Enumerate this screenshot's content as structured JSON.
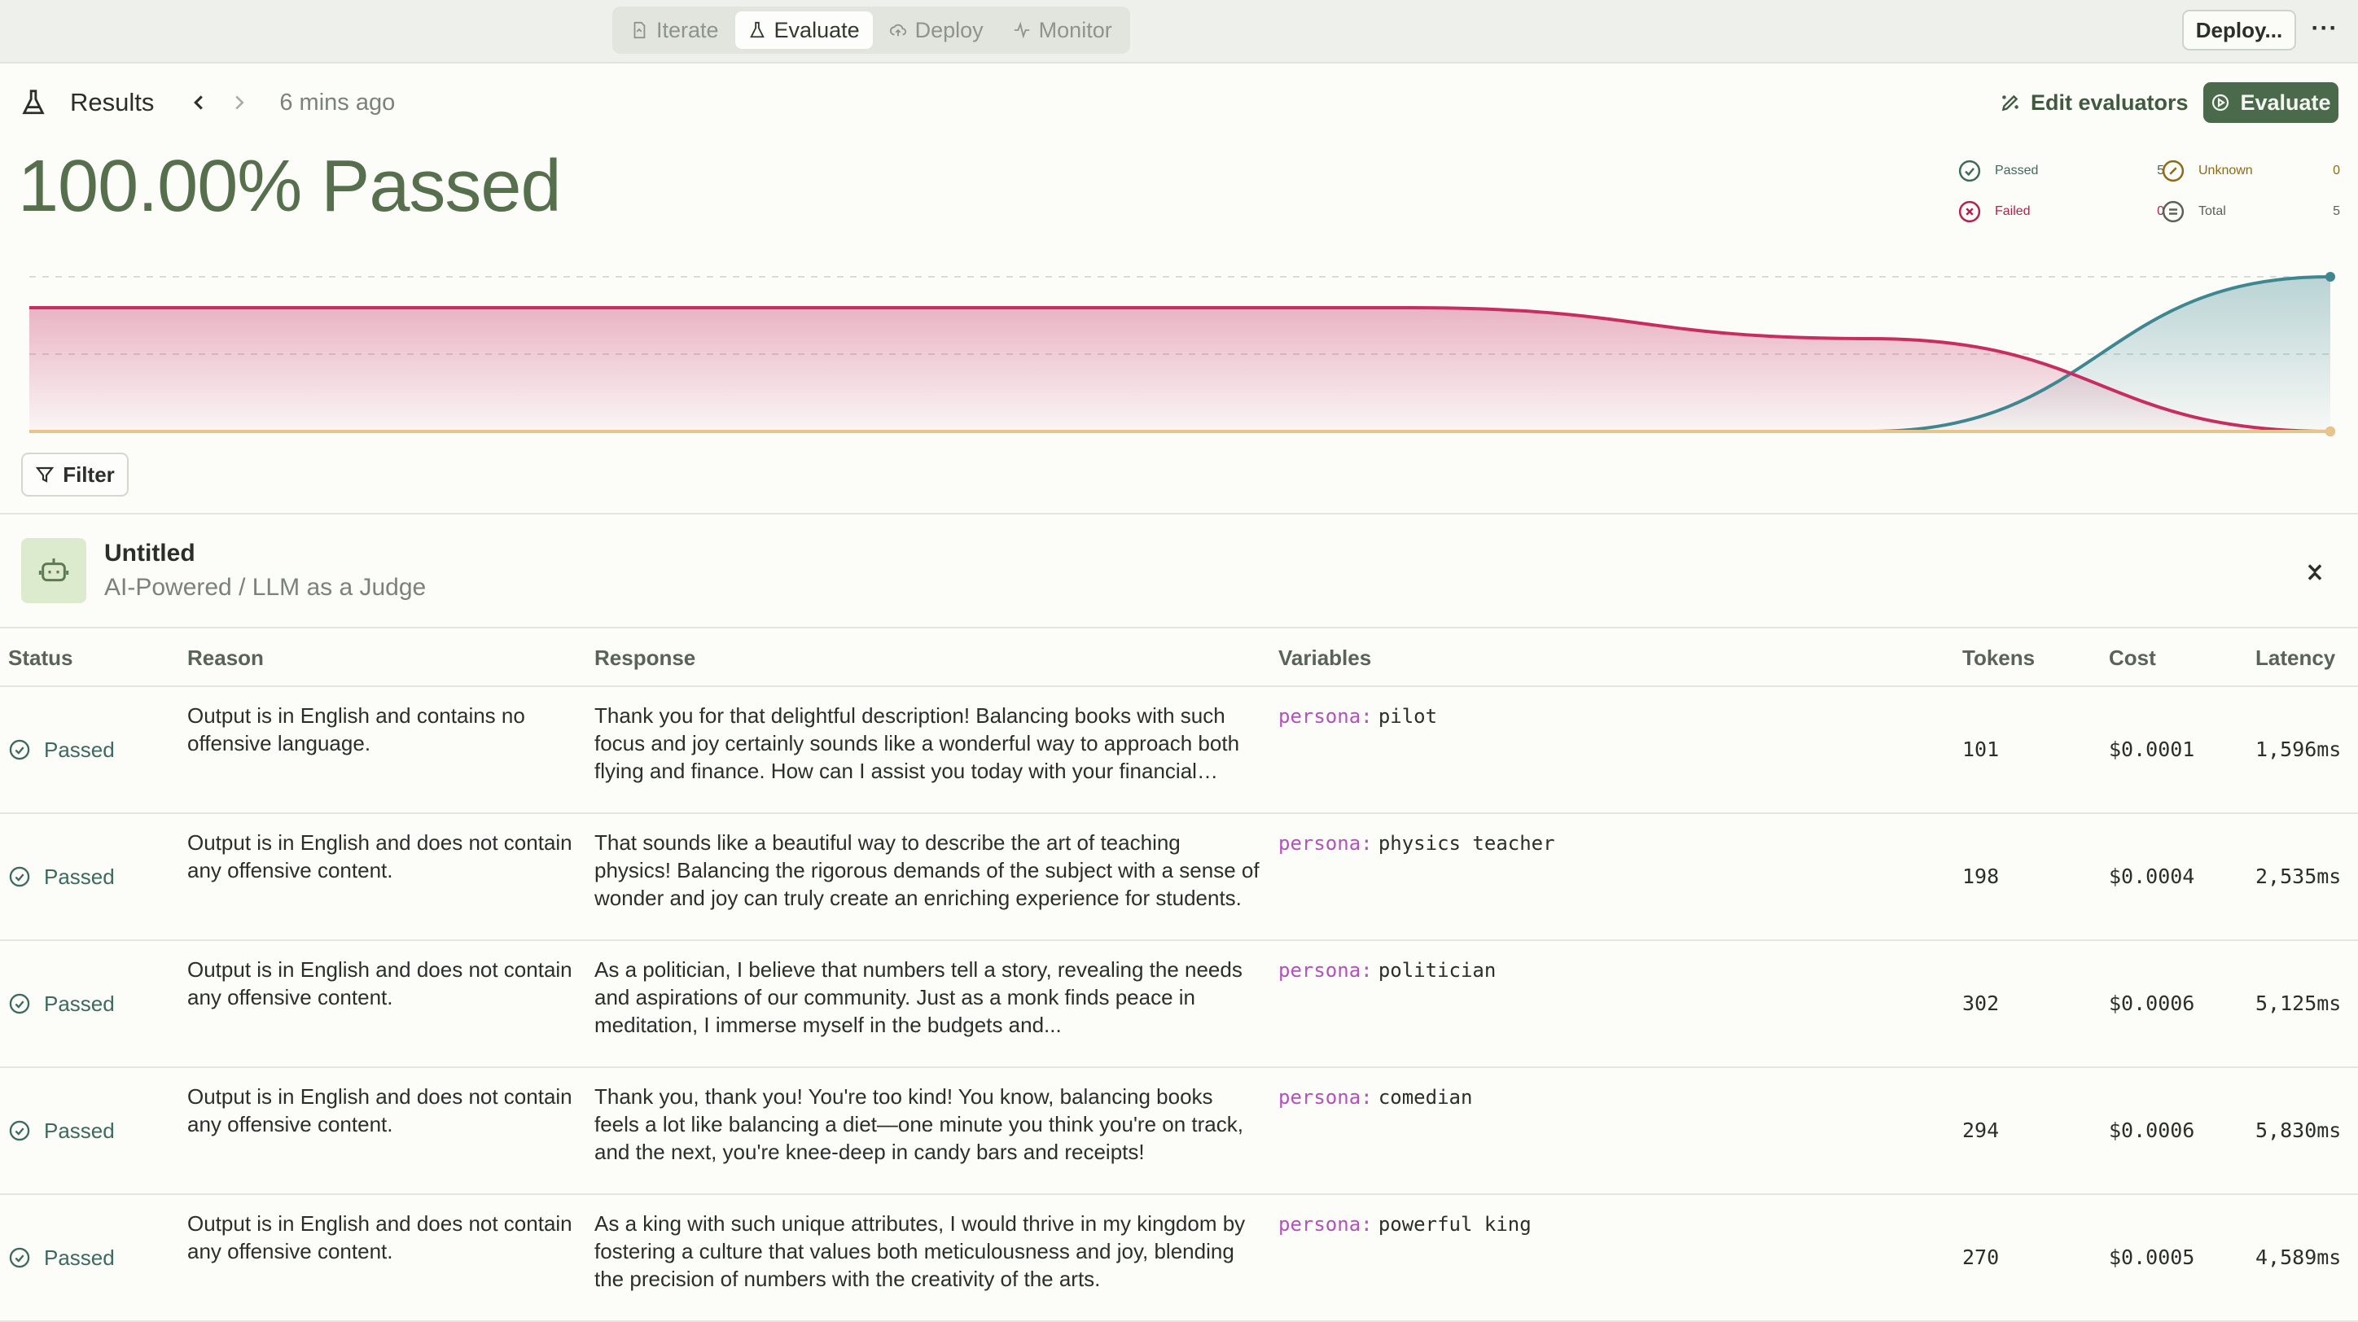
{
  "modes": [
    {
      "label": "Iterate",
      "active": false,
      "icon": "document-icon"
    },
    {
      "label": "Evaluate",
      "active": true,
      "icon": "flask-icon"
    },
    {
      "label": "Deploy",
      "active": false,
      "icon": "cloud-upload-icon"
    },
    {
      "label": "Monitor",
      "active": false,
      "icon": "activity-icon"
    }
  ],
  "topbar": {
    "deploy_label": "Deploy...",
    "more_label": "···"
  },
  "results": {
    "title": "Results",
    "time": "6 mins ago",
    "edit_evaluators": "Edit evaluators",
    "evaluate": "Evaluate",
    "pass_rate": "100.00% Passed"
  },
  "stats": {
    "passed": {
      "label": "Passed",
      "value": "5",
      "color": "#3d6a5e"
    },
    "failed": {
      "label": "Failed",
      "value": "0",
      "color": "#b3224c"
    },
    "unknown": {
      "label": "Unknown",
      "value": "0",
      "color": "#8f6a14"
    },
    "total": {
      "label": "Total",
      "value": "5",
      "color": "#5a6358"
    }
  },
  "chart_data": {
    "type": "area",
    "series": [
      {
        "name": "Passed",
        "color": "#3f8790",
        "values": [
          0,
          0,
          0,
          0,
          0,
          5
        ]
      },
      {
        "name": "Failed",
        "color": "#c62e62",
        "values": [
          4,
          4,
          4,
          4,
          3,
          0
        ]
      },
      {
        "name": "Unknown",
        "color": "#e8c48a",
        "values": [
          0,
          0,
          0,
          0,
          0,
          0
        ]
      }
    ],
    "ylim": [
      0,
      5
    ],
    "grid": true
  },
  "filter_label": "Filter",
  "evaluator": {
    "name": "Untitled",
    "type": "AI-Powered / LLM as a Judge"
  },
  "table": {
    "headers": {
      "status": "Status",
      "reason": "Reason",
      "response": "Response",
      "variables": "Variables",
      "tokens": "Tokens",
      "cost": "Cost",
      "latency": "Latency"
    },
    "rows": [
      {
        "status": "Passed",
        "reason": "Output is in English and contains no offensive language.",
        "response": "Thank you for that delightful description! Balancing books with such focus and joy certainly sounds like a wonderful way to approach both flying and finance. How can I assist you today with your financial tasks?",
        "var_key": "persona:",
        "var_value": "pilot",
        "tokens": "101",
        "cost": "$0.0001",
        "latency": "1,596ms"
      },
      {
        "status": "Passed",
        "reason": "Output is in English and does not contain any offensive content.",
        "response": "That sounds like a beautiful way to describe the art of teaching physics! Balancing the rigorous demands of the subject with a sense of wonder and joy can truly create an enriching experience for students.",
        "var_key": "persona:",
        "var_value": "physics teacher",
        "tokens": "198",
        "cost": "$0.0004",
        "latency": "2,535ms"
      },
      {
        "status": "Passed",
        "reason": "Output is in English and does not contain any offensive content.",
        "response": "As a politician, I believe that numbers tell a story, revealing the needs and aspirations of our community. Just as a monk finds peace in meditation, I immerse myself in the budgets and...",
        "var_key": "persona:",
        "var_value": "politician",
        "tokens": "302",
        "cost": "$0.0006",
        "latency": "5,125ms"
      },
      {
        "status": "Passed",
        "reason": "Output is in English and does not contain any offensive content.",
        "response": "Thank you, thank you! You're too kind! You know, balancing books feels a lot like balancing a diet—one minute you think you're on track, and the next, you're knee-deep in candy bars and receipts!",
        "var_key": "persona:",
        "var_value": "comedian",
        "tokens": "294",
        "cost": "$0.0006",
        "latency": "5,830ms"
      },
      {
        "status": "Passed",
        "reason": "Output is in English and does not contain any offensive content.",
        "response": "As a king with such unique attributes, I would thrive in my kingdom by fostering a culture that values both meticulousness and joy, blending the precision of numbers with the creativity of the arts.",
        "var_key": "persona:",
        "var_value": "powerful king",
        "tokens": "270",
        "cost": "$0.0005",
        "latency": "4,589ms"
      }
    ]
  }
}
